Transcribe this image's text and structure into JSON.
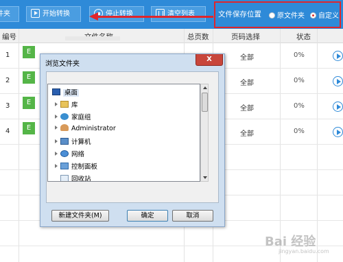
{
  "toolbar": {
    "file_btn": "件夹",
    "start_btn": "开始转换",
    "stop_btn": "停止转换",
    "clear_btn": "清空列表",
    "save_label": "文件保存位置",
    "opt_original": "原文件夹",
    "opt_custom": "自定义",
    "selected_option": "自定义"
  },
  "table": {
    "headers": {
      "num": "编号",
      "name": "文件名称",
      "pages": "总页数",
      "range": "页码选择",
      "status": "状态"
    },
    "rows": [
      {
        "num": "1",
        "icon": "E",
        "range": "全部",
        "status": "0%"
      },
      {
        "num": "2",
        "icon": "E",
        "range": "全部",
        "status": "0%"
      },
      {
        "num": "3",
        "icon": "E",
        "range": "全部",
        "status": "0%"
      },
      {
        "num": "4",
        "icon": "E",
        "range": "全部",
        "status": "0%"
      }
    ]
  },
  "dialog": {
    "title": "浏览文件夹",
    "close": "X",
    "tree": [
      "桌面",
      "库",
      "家庭组",
      "Administrator",
      "计算机",
      "网络",
      "控制面板",
      "回收站"
    ],
    "new_folder_btn": "新建文件夹(M)",
    "ok_btn": "确定",
    "cancel_btn": "取消"
  },
  "watermark": {
    "main": "Bai 经验",
    "sub": "jingyan.baidu.com"
  },
  "colors": {
    "toolbar": "#2e8ad8",
    "highlight": "#e0252b",
    "excel_icon": "#54b547"
  }
}
